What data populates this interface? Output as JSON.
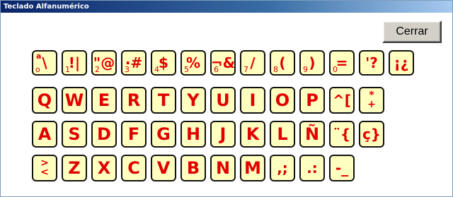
{
  "window": {
    "title": "Teclado Alfanumérico"
  },
  "buttons": {
    "close_label": "Cerrar"
  },
  "rows": [
    [
      {
        "sup": "a",
        "sub": "o",
        "main": "\\"
      },
      {
        "sub": "1",
        "main": "!|"
      },
      {
        "sub": "2",
        "main": "\"@"
      },
      {
        "sub": "3",
        "main": "·#"
      },
      {
        "sub": "4",
        "main": "$"
      },
      {
        "sub": "5",
        "main": "%"
      },
      {
        "sub": "6",
        "main": "¬&"
      },
      {
        "sub": "7",
        "main": "/"
      },
      {
        "sub": "8",
        "main": "("
      },
      {
        "sub": "9",
        "main": ")"
      },
      {
        "sub": "0",
        "main": "="
      },
      {
        "main": "'?"
      },
      {
        "main": "¡¿"
      }
    ],
    [
      {
        "main": "Q"
      },
      {
        "main": "W"
      },
      {
        "main": "E"
      },
      {
        "main": "R"
      },
      {
        "main": "T"
      },
      {
        "main": "Y"
      },
      {
        "main": "U"
      },
      {
        "main": "I"
      },
      {
        "main": "O"
      },
      {
        "main": "P"
      },
      {
        "main": "^["
      },
      {
        "main": "*]",
        "stack": [
          "*",
          "+"
        ]
      }
    ],
    [
      {
        "main": "A"
      },
      {
        "main": "S"
      },
      {
        "main": "D"
      },
      {
        "main": "F"
      },
      {
        "main": "G"
      },
      {
        "main": "H"
      },
      {
        "main": "J"
      },
      {
        "main": "K"
      },
      {
        "main": "L"
      },
      {
        "main": "Ñ"
      },
      {
        "main": "¨{"
      },
      {
        "main": "ç}"
      }
    ],
    [
      {
        "main": "≥",
        "stack": [
          ">",
          "<"
        ]
      },
      {
        "main": "Z"
      },
      {
        "main": "X"
      },
      {
        "main": "C"
      },
      {
        "main": "V"
      },
      {
        "main": "B"
      },
      {
        "main": "N"
      },
      {
        "main": "M"
      },
      {
        "main": ",;"
      },
      {
        "main": ".:"
      },
      {
        "main": "-_"
      }
    ]
  ]
}
